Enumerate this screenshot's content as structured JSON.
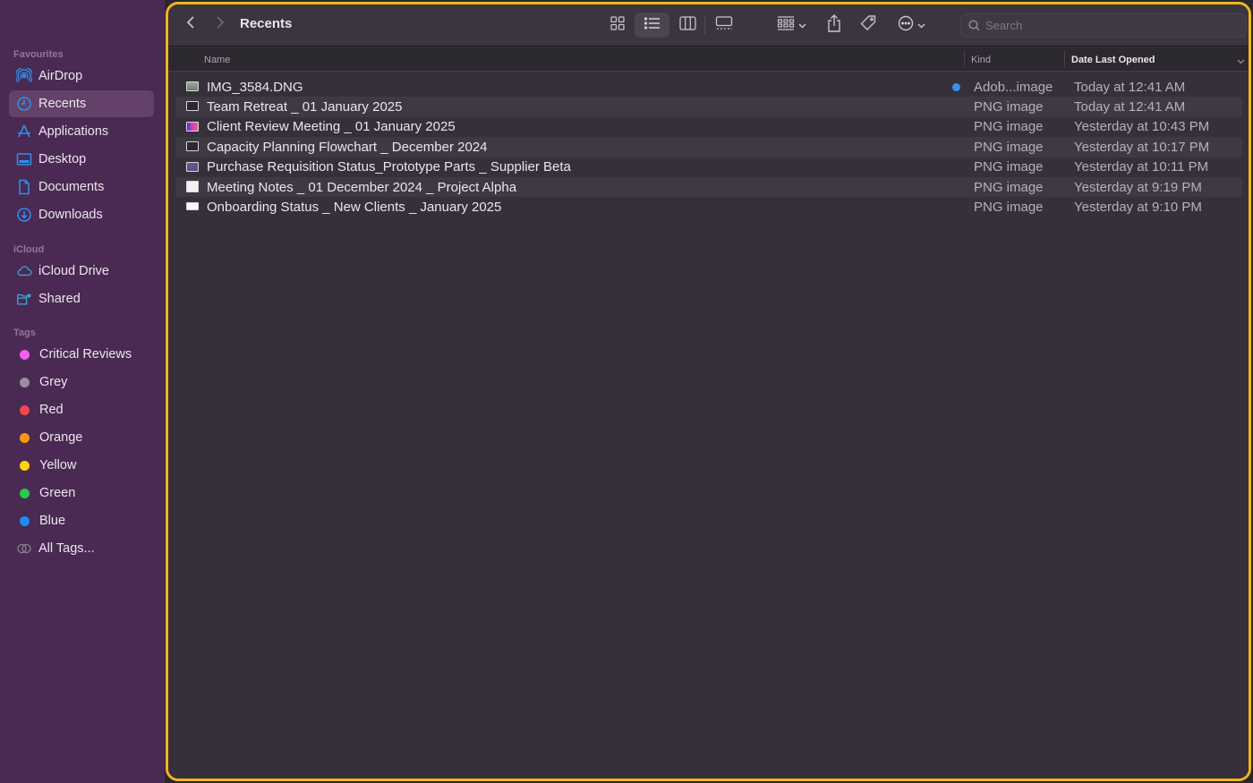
{
  "sidebar": {
    "sections": {
      "favourites": "Favourites",
      "icloud": "iCloud",
      "tags": "Tags"
    },
    "favourites": [
      {
        "label": "AirDrop",
        "icon": "airdrop-icon"
      },
      {
        "label": "Recents",
        "icon": "clock-icon",
        "active": true
      },
      {
        "label": "Applications",
        "icon": "applications-icon"
      },
      {
        "label": "Desktop",
        "icon": "desktop-icon"
      },
      {
        "label": "Documents",
        "icon": "document-icon"
      },
      {
        "label": "Downloads",
        "icon": "download-icon"
      }
    ],
    "icloud": [
      {
        "label": "iCloud Drive",
        "icon": "cloud-icon"
      },
      {
        "label": "Shared",
        "icon": "shared-folder-icon"
      }
    ],
    "tags": [
      {
        "label": "Critical Reviews",
        "color": "#f25ff0"
      },
      {
        "label": "Grey",
        "color": "#9a8d9e"
      },
      {
        "label": "Red",
        "color": "#f4474f"
      },
      {
        "label": "Orange",
        "color": "#fb9a0e"
      },
      {
        "label": "Yellow",
        "color": "#fed70a"
      },
      {
        "label": "Green",
        "color": "#26cb4a"
      },
      {
        "label": "Blue",
        "color": "#1b8cf7"
      },
      {
        "label": "All Tags...",
        "color": null
      }
    ]
  },
  "toolbar": {
    "title": "Recents",
    "back_icon": "chevron-left-icon",
    "forward_icon": "chevron-right-icon",
    "view_modes": [
      "icon-view",
      "list-view",
      "column-view",
      "gallery-view"
    ],
    "selected_view": "list-view",
    "search_placeholder": "Search",
    "search_value": ""
  },
  "columns": {
    "name": "Name",
    "kind": "Kind",
    "date": "Date Last Opened"
  },
  "files": [
    {
      "name": "IMG_3584.DNG",
      "kind": "Adob...image",
      "date": "Today at 12:41 AM",
      "tagged": true,
      "thumb": "#8a9a8a"
    },
    {
      "name": "Team Retreat _ 01 January 2025",
      "kind": "PNG image",
      "date": "Today at 12:41 AM",
      "tagged": false,
      "thumb": "#2b2830"
    },
    {
      "name": "Client Review Meeting _ 01 January 2025",
      "kind": "PNG image",
      "date": "Yesterday at 10:43 PM",
      "tagged": false,
      "thumb": "#c240d0"
    },
    {
      "name": "Capacity Planning Flowchart _ December 2024",
      "kind": "PNG image",
      "date": "Yesterday at 10:17 PM",
      "tagged": false,
      "thumb": "#2b2830"
    },
    {
      "name": "Purchase Requisition Status_Prototype Parts _ Supplier Beta",
      "kind": "PNG image",
      "date": "Yesterday at 10:11 PM",
      "tagged": false,
      "thumb": "#4a5070"
    },
    {
      "name": "Meeting Notes _ 01 December 2024 _ Project Alpha",
      "kind": "PNG image",
      "date": "Yesterday at 9:19 PM",
      "tagged": false,
      "thumb": "#f2f2f2"
    },
    {
      "name": "Onboarding Status _ New Clients _ January 2025",
      "kind": "PNG image",
      "date": "Yesterday at 9:10 PM",
      "tagged": false,
      "thumb": "#f8f8f8"
    }
  ],
  "colors": {
    "accent_border": "#f3b61a",
    "sidebar_bg": "#4a2a52",
    "sidebar_icon": "#2f8ff0"
  }
}
